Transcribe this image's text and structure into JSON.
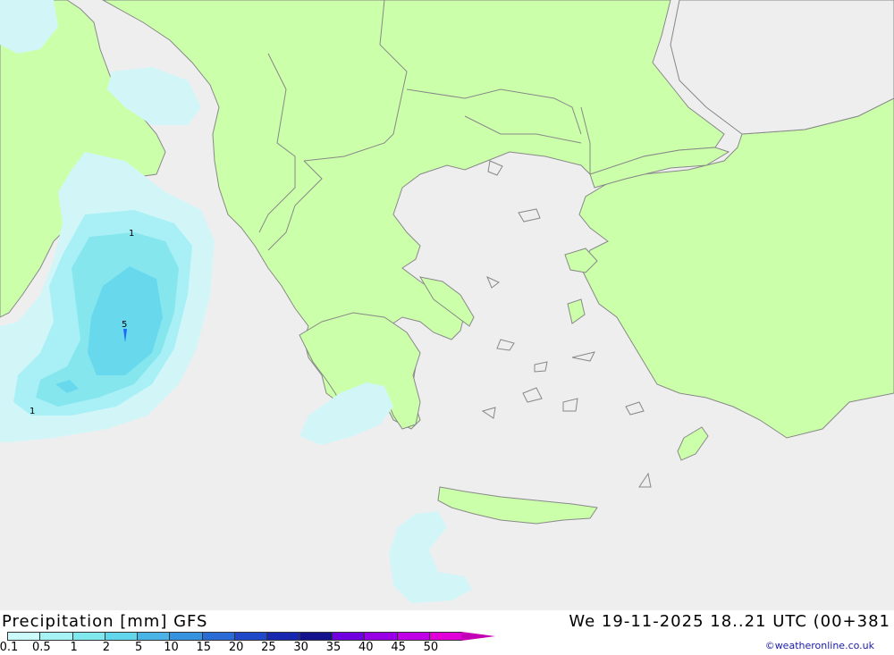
{
  "title": "Precipitation [mm] GFS",
  "valid_time": "We 19-11-2025 18..21 UTC (00+381",
  "credit": "©weatheronline.co.uk",
  "legend": {
    "colors": [
      "#ccfbfc",
      "#a6f3f5",
      "#80e9ee",
      "#62d6ea",
      "#4ab4e6",
      "#3792e0",
      "#2a6bd6",
      "#2049c9",
      "#1828b0",
      "#14118e",
      "#7000e0",
      "#9800e6",
      "#c000e6",
      "#e000d8",
      "#c400b6"
    ],
    "labels": [
      "0.1",
      "0.5",
      "1",
      "2",
      "5",
      "10",
      "15",
      "20",
      "25",
      "30",
      "35",
      "40",
      "45",
      "50"
    ]
  },
  "contour_labels": [
    "1",
    "5",
    "1"
  ],
  "colors": {
    "sea": "#eeeeee",
    "land": "#ccffaa",
    "border": "#888888",
    "precip_light": "#d2f6f8",
    "precip_mid": "#a8f0f6",
    "precip_1": "#86e6ee",
    "precip_2": "#68d8ec"
  }
}
